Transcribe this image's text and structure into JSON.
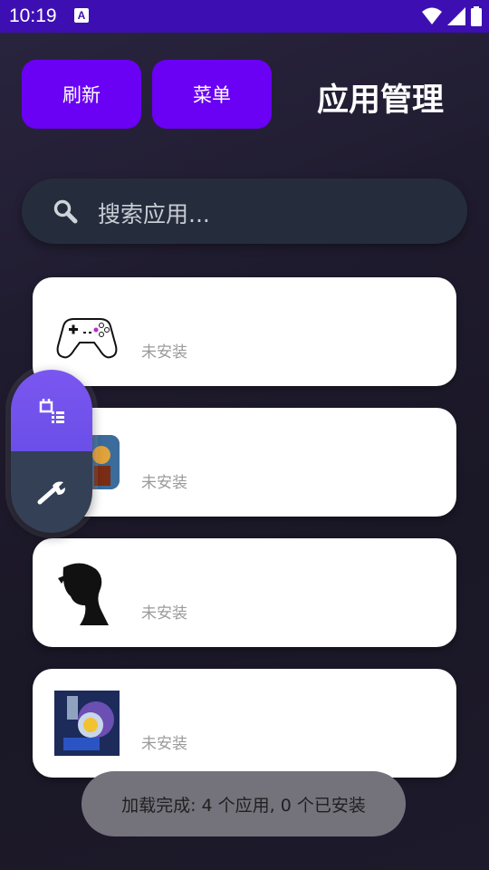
{
  "status_bar": {
    "time": "10:19",
    "notification_letter": "A"
  },
  "header": {
    "refresh_label": "刷新",
    "menu_label": "菜单",
    "title": "应用管理"
  },
  "search": {
    "placeholder": "搜索应用..."
  },
  "apps": [
    {
      "icon": "gamepad-icon",
      "status": "未安装"
    },
    {
      "icon": "game-art-icon",
      "status": "未安装"
    },
    {
      "icon": "silhouette-art-icon",
      "status": "未安装"
    },
    {
      "icon": "space-game-icon",
      "status": "未安装"
    }
  ],
  "floating_bar": {
    "top_icon": "app-list-icon",
    "bottom_icon": "wrench-icon"
  },
  "toast": {
    "message": "加载完成: 4 个应用, 0 个已安装"
  },
  "colors": {
    "status_bar": "#3d0fb3",
    "accent": "#6a00f4",
    "search_bg": "#252d3d",
    "float_top": "#7b56f0",
    "float_bottom": "#344055"
  }
}
